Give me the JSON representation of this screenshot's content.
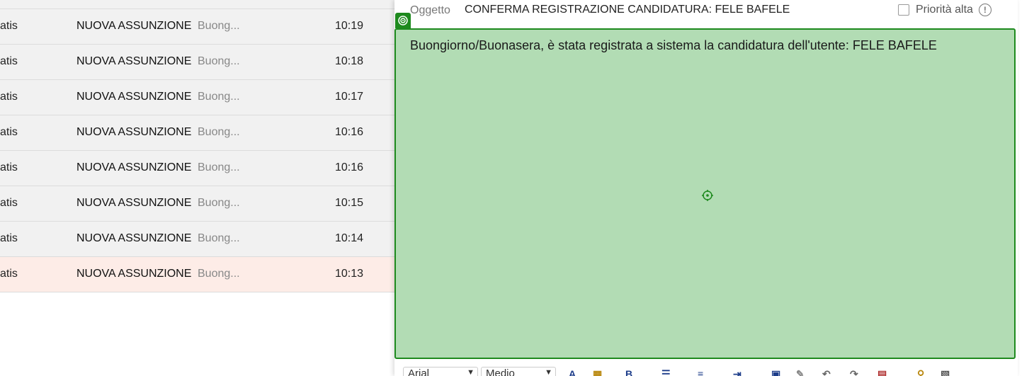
{
  "message_list": {
    "rows": [
      {
        "sender": "atis",
        "subject": "NUOVA ASSUNZIONE",
        "preview": "Buong...",
        "time": "10:19"
      },
      {
        "sender": "atis",
        "subject": "NUOVA ASSUNZIONE",
        "preview": "Buong...",
        "time": "10:18"
      },
      {
        "sender": "atis",
        "subject": "NUOVA ASSUNZIONE",
        "preview": "Buong...",
        "time": "10:17"
      },
      {
        "sender": "atis",
        "subject": "NUOVA ASSUNZIONE",
        "preview": "Buong...",
        "time": "10:16"
      },
      {
        "sender": "atis",
        "subject": "NUOVA ASSUNZIONE",
        "preview": "Buong...",
        "time": "10:16"
      },
      {
        "sender": "atis",
        "subject": "NUOVA ASSUNZIONE",
        "preview": "Buong...",
        "time": "10:15"
      },
      {
        "sender": "atis",
        "subject": "NUOVA ASSUNZIONE",
        "preview": "Buong...",
        "time": "10:14"
      },
      {
        "sender": "atis",
        "subject": "NUOVA ASSUNZIONE",
        "preview": "Buong...",
        "time": "10:13",
        "selected": true
      }
    ]
  },
  "compose": {
    "subject_label": "Oggetto",
    "subject_value": "CONFERMA REGISTRAZIONE CANDIDATURA: FELE BAFELE",
    "priority_label": "Priorità alta",
    "priority_info_icon": "info-icon",
    "body_text": "Buongiorno/Buonasera, è stata registrata a sistema la candidatura dell'utente: FELE BAFELE",
    "highlight_color": "#b2dcb4",
    "highlight_border": "#1e8a1e"
  },
  "toolbar": {
    "font_family": "Arial",
    "font_size": "Medio",
    "buttons": [
      "text-color-icon",
      "background-color-icon",
      "bold-icon",
      "list-icon",
      "align-icon",
      "indent-icon",
      "special-icon",
      "eraser-icon",
      "undo-icon",
      "redo-icon",
      "table-icon",
      "link-icon",
      "image-icon"
    ]
  }
}
